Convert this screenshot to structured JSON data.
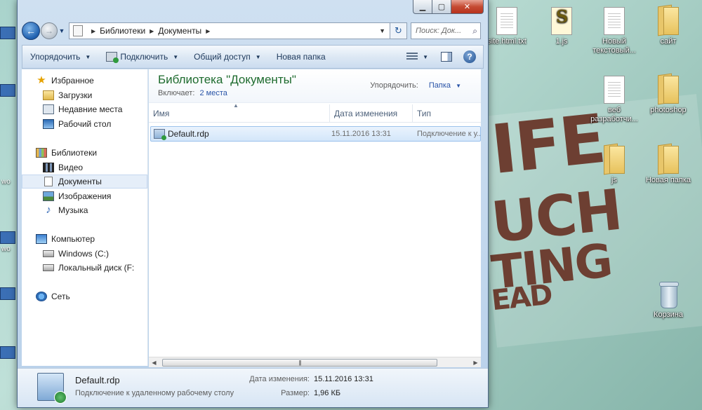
{
  "window": {
    "caption": {
      "minimize": "▁",
      "maximize": "▢",
      "close": "✕"
    },
    "address": {
      "segments": [
        "Библиотеки",
        "Документы"
      ],
      "search_placeholder": "Поиск: Док..."
    },
    "toolbar": {
      "organize": "Упорядочить",
      "connect": "Подключить",
      "share": "Общий доступ",
      "new_folder": "Новая папка"
    },
    "nav_pane": {
      "favorites": {
        "label": "Избранное",
        "items": [
          "Загрузки",
          "Недавние места",
          "Рабочий стол"
        ]
      },
      "libraries": {
        "label": "Библиотеки",
        "items": [
          "Видео",
          "Документы",
          "Изображения",
          "Музыка"
        ]
      },
      "computer": {
        "label": "Компьютер",
        "items": [
          "Windows (C:)",
          "Локальный диск (F:"
        ]
      },
      "network": {
        "label": "Сеть"
      }
    },
    "library_header": {
      "title": "Библиотека \"Документы\"",
      "includes_label": "Включает:",
      "includes_link": "2 места",
      "arrange_label": "Упорядочить:",
      "arrange_value": "Папка"
    },
    "columns": [
      "Имя",
      "Дата изменения",
      "Тип"
    ],
    "files": [
      {
        "name": "Default.rdp",
        "date": "15.11.2016 13:31",
        "type": "Подключение к у..."
      }
    ],
    "details": {
      "name": "Default.rdp",
      "type": "Подключение к удаленному рабочему столу",
      "date_label": "Дата изменения:",
      "date_value": "15.11.2016 13:31",
      "size_label": "Размер:",
      "size_value": "1,96 КБ"
    }
  },
  "desktop": {
    "icons": [
      {
        "label": "site.html.txt"
      },
      {
        "label": "1.js"
      },
      {
        "label": "Новый текстовый..."
      },
      {
        "label": "сайт"
      },
      {
        "label": "веб разработчи..."
      },
      {
        "label": "photoshop"
      },
      {
        "label": "js"
      },
      {
        "label": "Новая папка"
      },
      {
        "label": "Корзина"
      }
    ],
    "left_edge_labels": [
      "wo",
      "wo"
    ],
    "wallpaper_lines": [
      "IFE",
      "UCH",
      "TING",
      "EAD"
    ]
  }
}
